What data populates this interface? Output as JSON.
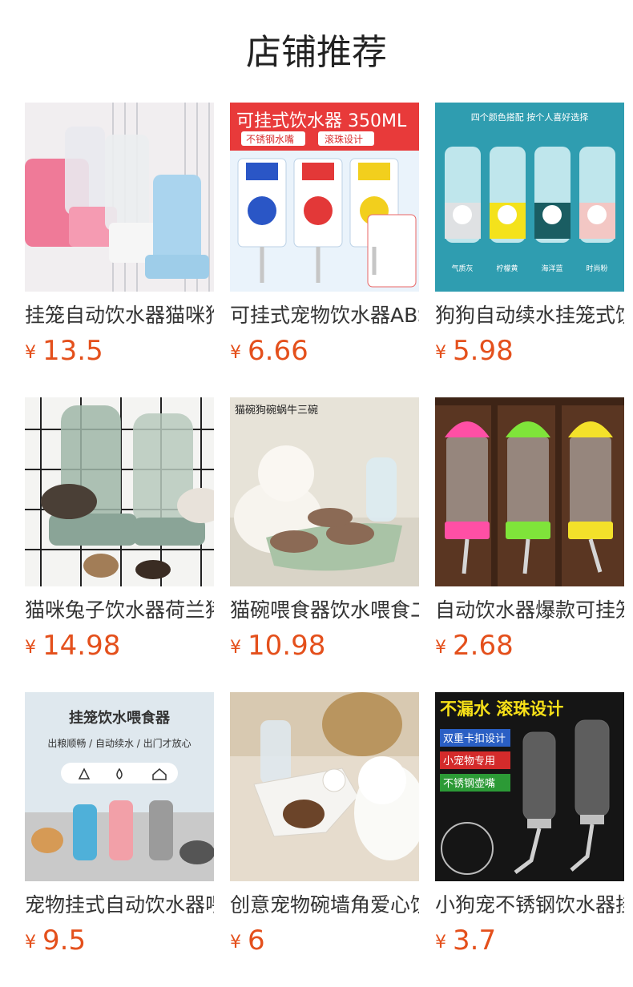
{
  "page": {
    "title": "店铺推荐"
  },
  "currency_symbol": "¥",
  "products": [
    {
      "name": "挂笼自动饮水器猫咪狗狗",
      "price": "13.5",
      "image": "cage-waterer-pastel"
    },
    {
      "name": "可挂式宠物饮水器ABS材质",
      "price": "6.66",
      "image": "hanging-bottles-350ml",
      "image_text": [
        "可挂式饮水器 350ML",
        "不锈钢水嘴",
        "滚珠设计"
      ]
    },
    {
      "name": "狗狗自动续水挂笼式饮水器",
      "price": "5.98",
      "image": "four-colors-waterer",
      "image_text": [
        "四个颜色搭配 按个人喜好选择",
        "气质灰",
        "柠檬黄",
        "海洋蓝",
        "时尚粉"
      ]
    },
    {
      "name": "猫咪兔子饮水器荷兰猪",
      "price": "14.98",
      "image": "feeder-with-pets"
    },
    {
      "name": "猫碗喂食器饮水喂食二合一",
      "price": "10.98",
      "image": "snail-bowl",
      "image_text": [
        "猫碗狗碗蜗牛三碗"
      ]
    },
    {
      "name": "自动饮水器爆款可挂笼",
      "price": "2.68",
      "image": "colored-bottles"
    },
    {
      "name": "宠物挂式自动饮水器喂食",
      "price": "9.5",
      "image": "cage-feeder-banner",
      "image_text": [
        "挂笼饮水喂食器",
        "出粮顺畅 / 自动续水 / 出门才放心"
      ]
    },
    {
      "name": "创意宠物碗墙角爱心饮水",
      "price": "6",
      "image": "corner-bowl"
    },
    {
      "name": "小狗宠不锈钢饮水器挂式",
      "price": "3.7",
      "image": "steel-nozzle-bottles",
      "image_text": [
        "不漏水 滚珠设计",
        "双重卡扣设计",
        "小宠物专用",
        "不锈钢壶嘴"
      ]
    }
  ]
}
